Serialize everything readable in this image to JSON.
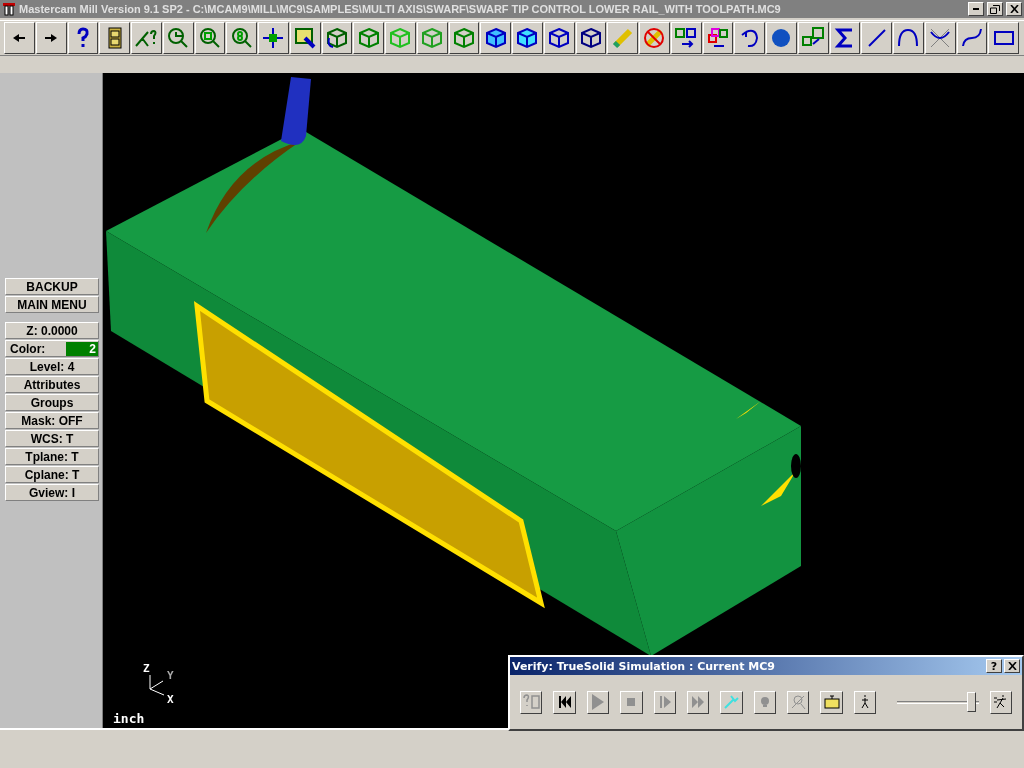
{
  "window": {
    "title": "Mastercam Mill Version 9.1 SP2 - C:\\MCAM9\\MILL\\MC9\\SAMPLES\\MULTI AXIS\\SWARF\\SWARF TIP CONTROL LOWER RAIL_WITH TOOLPATH.MC9"
  },
  "menu": {
    "items": [
      {
        "label": "BACKUP"
      },
      {
        "label": "MAIN MENU"
      }
    ]
  },
  "settings": [
    {
      "kind": "text",
      "label": "Z:  0.0000"
    },
    {
      "kind": "color",
      "label": "Color:",
      "value": "2",
      "color": "#008000"
    },
    {
      "kind": "text",
      "label": "Level:  4"
    },
    {
      "kind": "text",
      "label": "Attributes"
    },
    {
      "kind": "text",
      "label": "Groups"
    },
    {
      "kind": "text",
      "label": "Mask:  OFF"
    },
    {
      "kind": "text",
      "label": "WCS:   T"
    },
    {
      "kind": "text",
      "label": "Tplane:  T"
    },
    {
      "kind": "text",
      "label": "Cplane:  T"
    },
    {
      "kind": "text",
      "label": "Gview:   I"
    }
  ],
  "viewport": {
    "axes": {
      "z": "Z",
      "y": "Y",
      "x": "X"
    },
    "units": "inch"
  },
  "verify_dialog": {
    "title": "Verify: TrueSolid Simulation : Current MC9",
    "help": "?",
    "speed": {
      "level": 0.97
    }
  }
}
